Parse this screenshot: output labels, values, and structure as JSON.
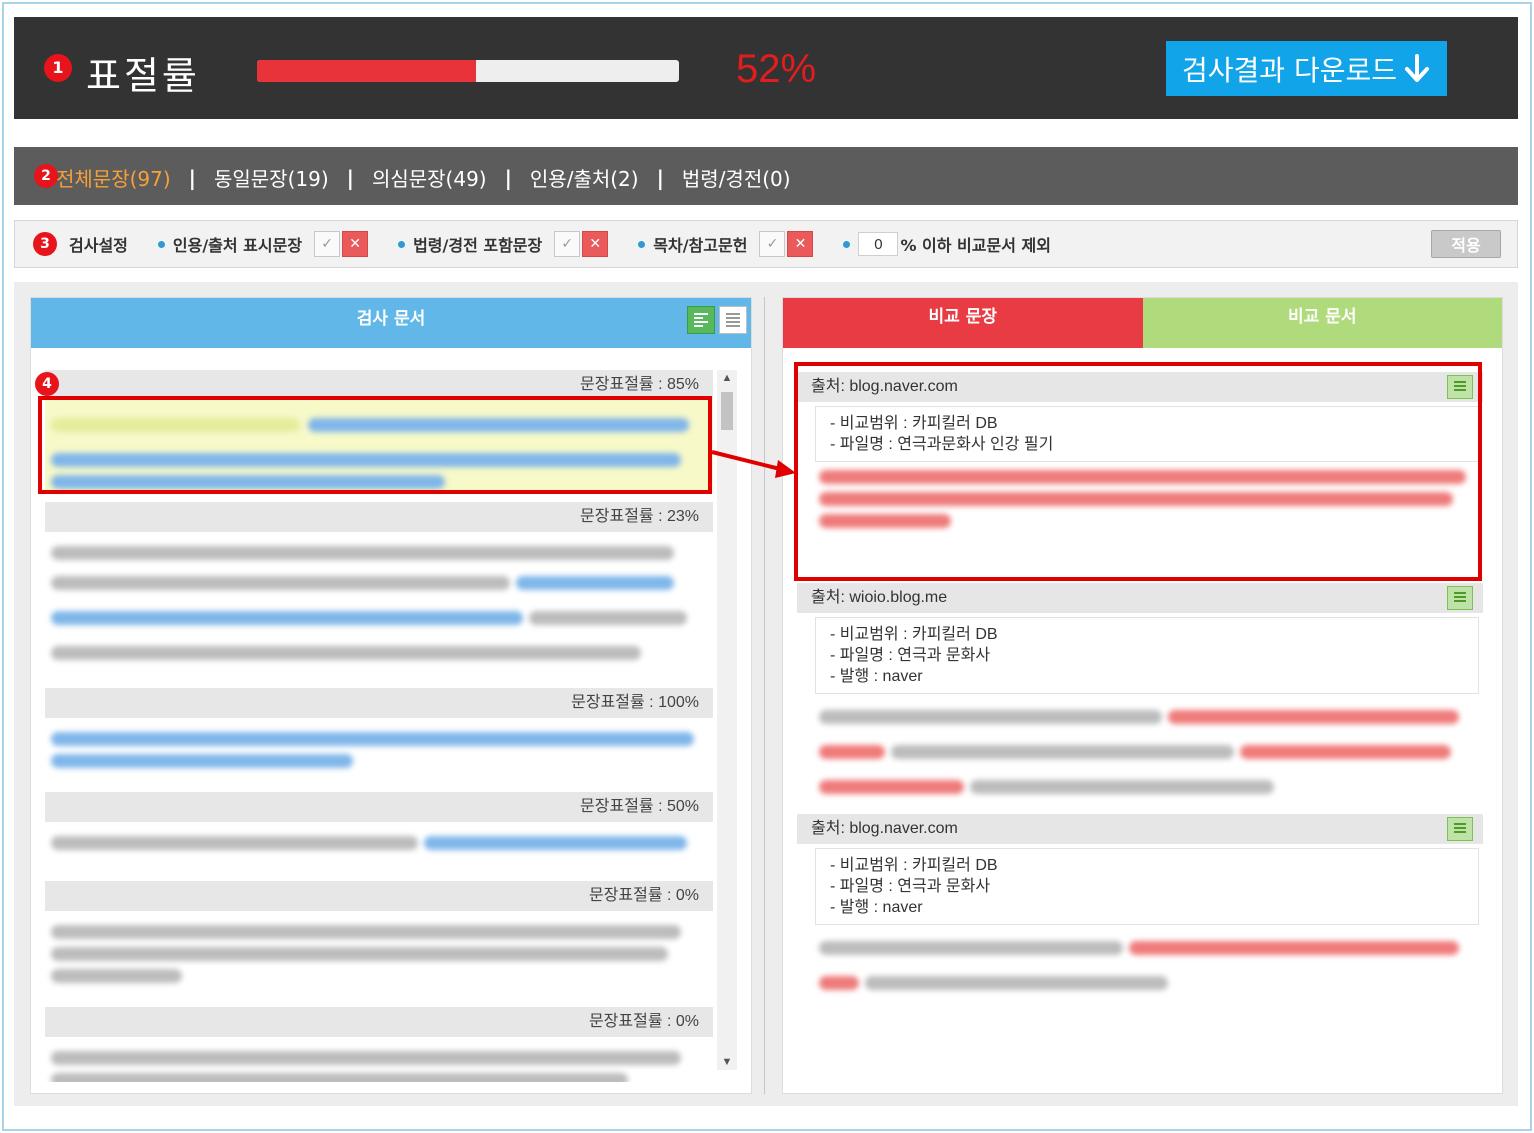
{
  "header": {
    "marker": "1",
    "title": "표절률",
    "progress": 0.52,
    "percent_text": "52%",
    "download_label": "검사결과 다운로드",
    "download_icon": "arrow-down-icon"
  },
  "tabbar": {
    "marker": "2",
    "tabs": [
      {
        "label": "전체문장(97)",
        "active": true
      },
      {
        "label": "동일문장(19)",
        "active": false
      },
      {
        "label": "의심문장(49)",
        "active": false
      },
      {
        "label": "인용/출처(2)",
        "active": false
      },
      {
        "label": "법령/경전(0)",
        "active": false
      }
    ],
    "separator": "|"
  },
  "settings": {
    "marker": "3",
    "title": "검사설정",
    "options": [
      {
        "label": "인용/출처 표시문장"
      },
      {
        "label": "법령/경전 포함문장"
      },
      {
        "label": "목차/참고문헌"
      }
    ],
    "threshold_value": "0",
    "threshold_label": "% 이하 비교문서 제외",
    "apply_label": "적용"
  },
  "left": {
    "marker": "4",
    "title": "검사 문서",
    "sentences": [
      {
        "rate": "문장표절률 : 85%"
      },
      {
        "rate": "문장표절률 : 23%"
      },
      {
        "rate": "문장표절률 : 100%"
      },
      {
        "rate": "문장표절률 : 50%"
      },
      {
        "rate": "문장표절률 : 0%"
      },
      {
        "rate": "문장표절률 : 0%"
      }
    ]
  },
  "right": {
    "tabs": [
      "비교 문장",
      "비교 문서"
    ],
    "sources": [
      {
        "source": "출처: blog.naver.com",
        "meta": [
          "- 비교범위 : 카피킬러 DB",
          "- 파일명 : 연극과문화사 인강 필기"
        ]
      },
      {
        "source": "출처: wioio.blog.me",
        "meta": [
          "- 비교범위 : 카피킬러 DB",
          "- 파일명 : 연극과 문화사",
          "- 발행 : naver"
        ]
      },
      {
        "source": "출처: blog.naver.com",
        "meta": [
          "- 비교범위 : 카피킬러 DB",
          "- 파일명 : 연극과 문화사",
          "- 발행 : naver"
        ]
      }
    ]
  },
  "colors": {
    "accent_red": "#e8333a",
    "accent_blue": "#11a4e8",
    "active_tab": "#f6a13a",
    "compare_sentence_tab": "#e83b43",
    "compare_doc_tab": "#afdb7c"
  }
}
